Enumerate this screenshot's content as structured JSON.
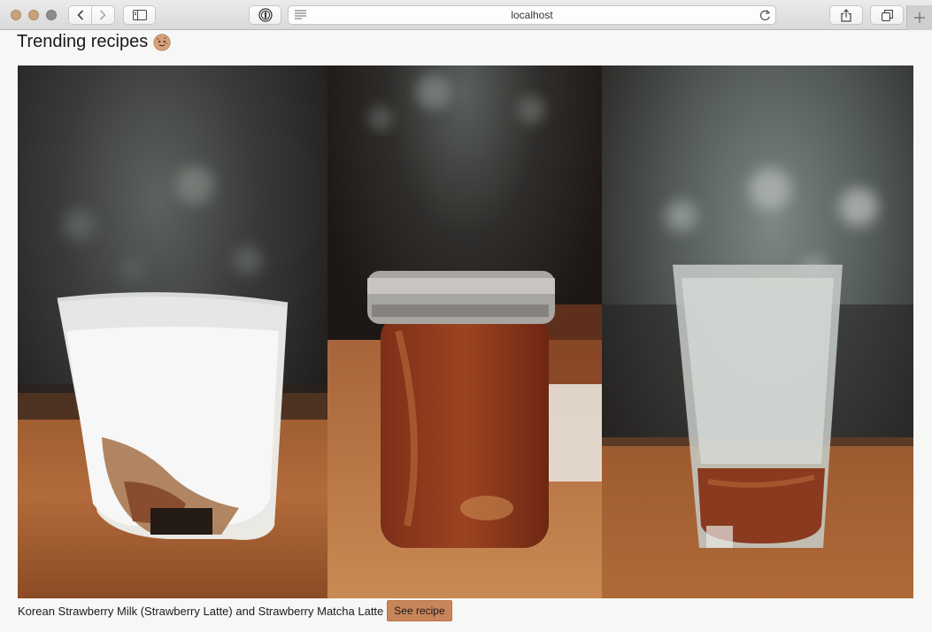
{
  "browser": {
    "url": "localhost",
    "icons": [
      "back-icon",
      "forward-icon",
      "sidebar-icon",
      "password-icon",
      "reader-icon",
      "reload-icon",
      "share-icon",
      "tabs-icon",
      "plus-icon"
    ]
  },
  "page": {
    "title": "Trending recipes",
    "title_emoji": "cookie-face-icon"
  },
  "recipe": {
    "caption": "Korean Strawberry Milk (Strawberry Latte) and Strawberry Matcha Latte",
    "button_label": "See recipe"
  },
  "colors": {
    "accent": "#c9855a",
    "background": "#f7f7f5"
  }
}
